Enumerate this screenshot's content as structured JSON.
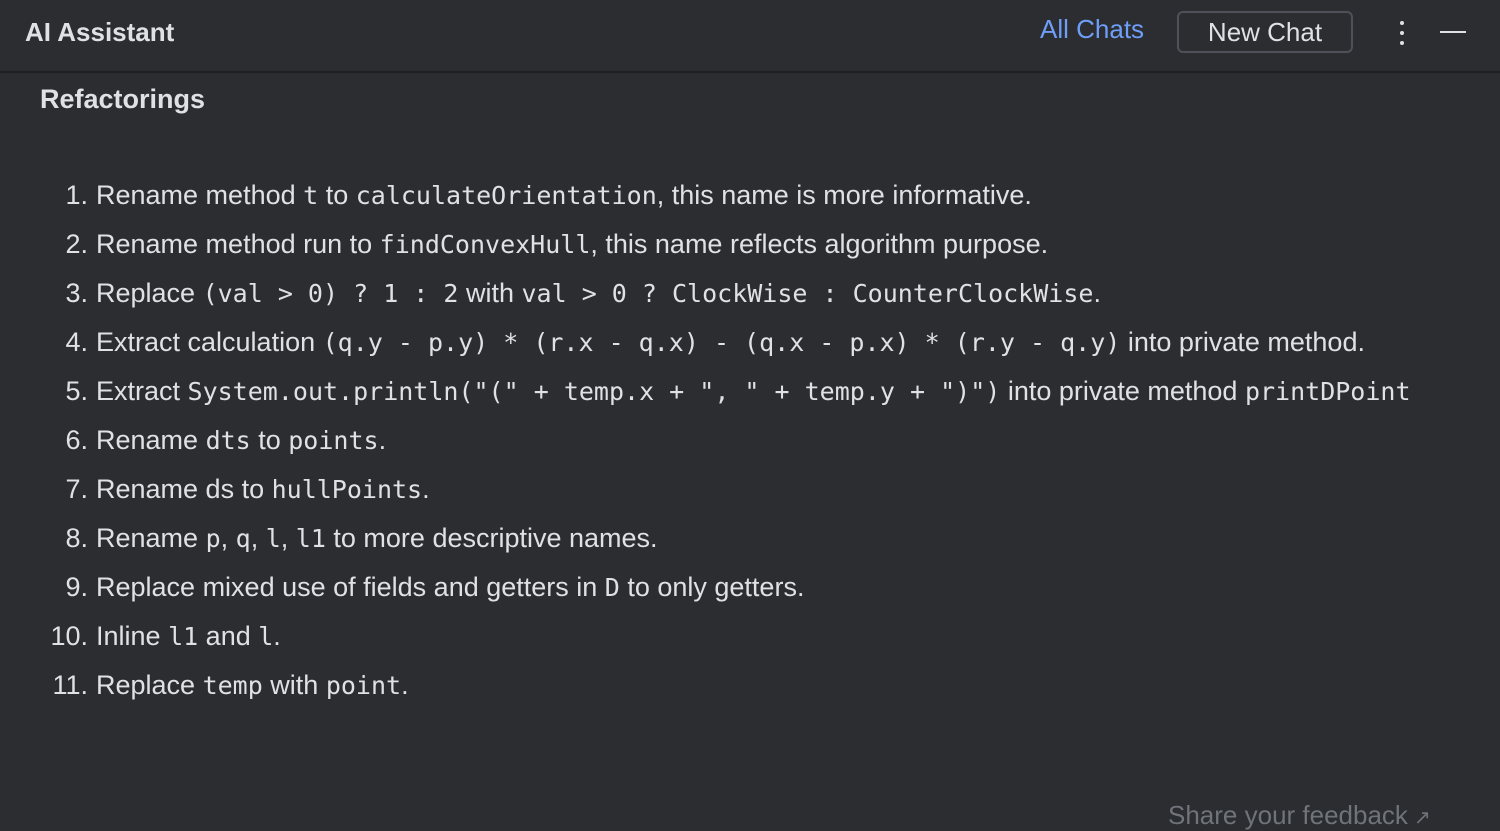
{
  "header": {
    "title": "AI Assistant",
    "all_chats": "All Chats",
    "new_chat": "New Chat"
  },
  "section": {
    "title": "Refactorings"
  },
  "items": [
    {
      "num": "1.",
      "parts": [
        {
          "t": "Rename method "
        },
        {
          "c": "t"
        },
        {
          "t": " to "
        },
        {
          "c": "calculateOrientation"
        },
        {
          "t": ", this name is more informative."
        }
      ]
    },
    {
      "num": "2.",
      "parts": [
        {
          "t": "Rename method run to "
        },
        {
          "c": "findConvexHull"
        },
        {
          "t": ", this name reflects algorithm purpose."
        }
      ]
    },
    {
      "num": "3.",
      "parts": [
        {
          "t": "Replace "
        },
        {
          "c": "(val > 0) ? 1 : 2"
        },
        {
          "t": " with "
        },
        {
          "c": "val > 0 ? ClockWise : CounterClockWise"
        },
        {
          "t": "."
        }
      ]
    },
    {
      "num": "4.",
      "parts": [
        {
          "t": "Extract calculation "
        },
        {
          "c": "(q.y - p.y) * (r.x - q.x) - (q.x - p.x) * (r.y - q.y)"
        },
        {
          "t": " into private method."
        }
      ]
    },
    {
      "num": "5.",
      "parts": [
        {
          "t": "Extract "
        },
        {
          "c": "System.out.println(\"(\" + temp.x + \", \" + temp.y + \")\")"
        },
        {
          "t": " into private method "
        },
        {
          "c": "printDPoint"
        }
      ]
    },
    {
      "num": "6.",
      "parts": [
        {
          "t": "Rename "
        },
        {
          "c": "dts"
        },
        {
          "t": " to "
        },
        {
          "c": "points"
        },
        {
          "t": "."
        }
      ]
    },
    {
      "num": "7.",
      "parts": [
        {
          "t": "Rename ds to "
        },
        {
          "c": "hullPoints"
        },
        {
          "t": "."
        }
      ]
    },
    {
      "num": "8.",
      "parts": [
        {
          "t": "Rename "
        },
        {
          "c": "p"
        },
        {
          "t": ", "
        },
        {
          "c": "q"
        },
        {
          "t": ", "
        },
        {
          "c": "l"
        },
        {
          "t": ", "
        },
        {
          "c": "l1"
        },
        {
          "t": " to more descriptive names."
        }
      ]
    },
    {
      "num": "9.",
      "parts": [
        {
          "t": "Replace mixed use of fields and getters in "
        },
        {
          "c": "D"
        },
        {
          "t": " to only getters."
        }
      ]
    },
    {
      "num": "10.",
      "parts": [
        {
          "t": "Inline "
        },
        {
          "c": "l1"
        },
        {
          "t": " and "
        },
        {
          "c": "l"
        },
        {
          "t": "."
        }
      ]
    },
    {
      "num": "11.",
      "parts": [
        {
          "t": "Replace "
        },
        {
          "c": "temp"
        },
        {
          "t": " with "
        },
        {
          "c": "point"
        },
        {
          "t": "."
        }
      ]
    }
  ],
  "footer": {
    "feedback": "Share your feedback",
    "feedback_icon": "external-arrow-icon"
  },
  "colors": {
    "background": "#2b2d30",
    "link": "#6f9ef8",
    "text": "#dfe1e5",
    "muted": "#6f737a"
  }
}
